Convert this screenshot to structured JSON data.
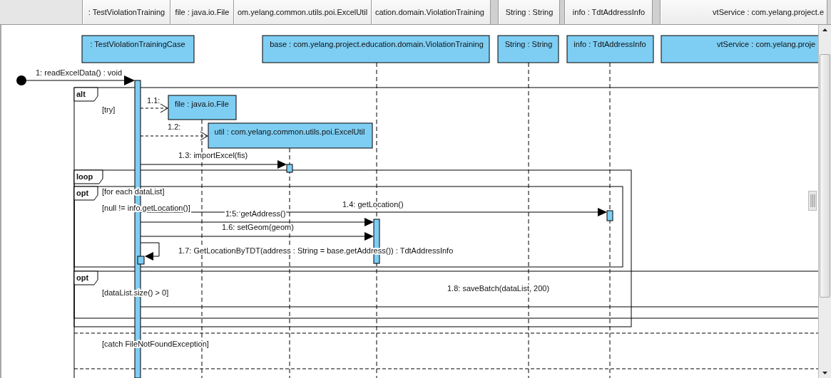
{
  "header_tabs": [
    ": TestViolationTraining",
    "file : java.io.File",
    "om.yelang.common.utils.poi.ExcelUtil",
    "cation.domain.ViolationTraining",
    "String : String",
    "info : TdtAddressInfo",
    "vtService : com.yelang.project.e"
  ],
  "lifelines": [
    {
      "label": ": TestViolationTrainingCase"
    },
    {
      "label": "base : com.yelang.project.education.domain.ViolationTraining"
    },
    {
      "label": "String : String"
    },
    {
      "label": "info : TdtAddressInfo"
    },
    {
      "label": "vtService : com.yelang.proje"
    },
    {
      "label": "file : java.io.File"
    },
    {
      "label": "util : com.yelang.common.utils.poi.ExcelUtil"
    }
  ],
  "fragments": [
    {
      "operator": "alt",
      "guards": [
        "[try]",
        "[catch FileNotFoundException]"
      ]
    },
    {
      "operator": "loop",
      "guards": [
        "[for each dataList]"
      ]
    },
    {
      "operator": "opt",
      "guards": [
        "[null != info.getLocation()]"
      ]
    },
    {
      "operator": "opt",
      "guards": [
        "[dataList.size() > 0]"
      ]
    }
  ],
  "messages": [
    {
      "kind": "found",
      "label": "1: readExcelData() : void"
    },
    {
      "kind": "create",
      "label": "1.1:"
    },
    {
      "kind": "create",
      "label": "1.2:"
    },
    {
      "kind": "call",
      "label": "1.3: importExcel(fis)"
    },
    {
      "kind": "call",
      "label": "1.4: getLocation()"
    },
    {
      "kind": "call",
      "label": "1.5: getAddress()"
    },
    {
      "kind": "call",
      "label": "1.6: setGeom(geom)"
    },
    {
      "kind": "self",
      "label": "1.7: GetLocationByTDT(address : String = base.getAddress()) : TdtAddressInfo"
    },
    {
      "kind": "call",
      "label": "1.8: saveBatch(dataList, 200)"
    }
  ]
}
